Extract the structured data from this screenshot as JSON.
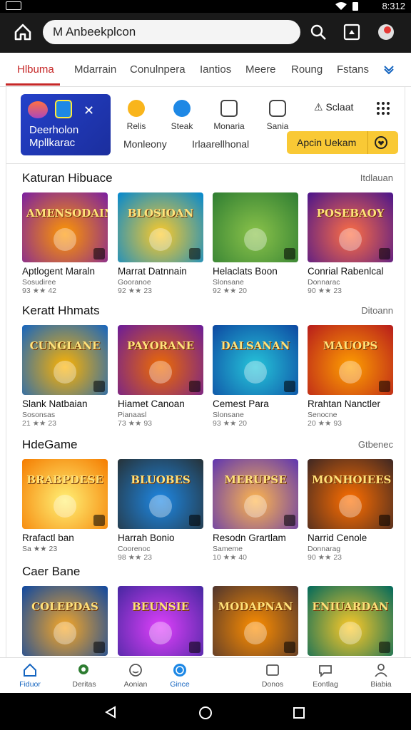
{
  "status": {
    "time": "8:312"
  },
  "appbar": {
    "search_text": "M Anbeekplcon"
  },
  "tabs": [
    {
      "label": "Hlbuma",
      "active": true
    },
    {
      "label": "Mdarrain"
    },
    {
      "label": "Conulnpera"
    },
    {
      "label": "Iantios"
    },
    {
      "label": "Meere"
    },
    {
      "label": "Roung"
    },
    {
      "label": "Fstans"
    }
  ],
  "featured": {
    "promo_text": "Deerholon Mpllkarac",
    "quick": [
      {
        "label": "Relis",
        "icon": "coin-icon"
      },
      {
        "label": "Steak",
        "icon": "compass-icon"
      },
      {
        "label": "Monaria",
        "icon": "chat-icon"
      },
      {
        "label": "Sania",
        "icon": "robot-icon"
      }
    ],
    "scan_label": "Sclaat",
    "text_left": "Monleony",
    "text_mid": "Irlaarellhonal",
    "install_label": "Apcin Uekam"
  },
  "sections": [
    {
      "title": "Katuran Hibuace",
      "more": "Itdlauan",
      "cards": [
        {
          "art": "AMENSODAIN",
          "name": "Aptlogent Maraln",
          "sub": "Sosudiree",
          "rating": "93 ★★ 42",
          "c1": "#7b1fa2",
          "c2": "#ff9800"
        },
        {
          "art": "BLOSIOAN",
          "name": "Marrat Datnnain",
          "sub": "Gooranoe",
          "rating": "92 ★★ 23",
          "c1": "#0288d1",
          "c2": "#ffca28"
        },
        {
          "art": "",
          "name": "Helaclats Boon",
          "sub": "Slonsane",
          "rating": "92 ★★ 20",
          "c1": "#2e7d32",
          "c2": "#8bc34a"
        },
        {
          "art": "POSEBAOY",
          "name": "Conrial Rabenlcal",
          "sub": "Donnarac",
          "rating": "90 ★★ 23",
          "c1": "#4a148c",
          "c2": "#ff7043"
        }
      ]
    },
    {
      "title": "Keratt Hhmats",
      "more": "Ditoann",
      "cards": [
        {
          "art": "CUNGLANE",
          "name": "Slank Natbaian",
          "sub": "Sosonsas",
          "rating": "21 ★★ 23",
          "c1": "#1565c0",
          "c2": "#ffb300"
        },
        {
          "art": "PAYORANE",
          "name": "Hiamet Canoan",
          "sub": "Pianaasl",
          "rating": "73 ★★ 93",
          "c1": "#6a1b9a",
          "c2": "#ef6c00"
        },
        {
          "art": "DALSANAN",
          "name": "Cemest Para",
          "sub": "Slonsane",
          "rating": "93 ★★ 20",
          "c1": "#0d47a1",
          "c2": "#26c6da"
        },
        {
          "art": "MAUOPS",
          "name": "Rrahtan Nanctler",
          "sub": "Senocne",
          "rating": "20 ★★ 93",
          "c1": "#b71c1c",
          "c2": "#ffa000"
        }
      ]
    },
    {
      "title": "HdeGame",
      "more": "Gtbenec",
      "cards": [
        {
          "art": "BRABPDESE",
          "name": "Rrafactl ban",
          "sub": "Sa ★★ 23",
          "rating": "",
          "c1": "#f57c00",
          "c2": "#fff176"
        },
        {
          "art": "BLUOBES",
          "name": "Harrah Bonio",
          "sub": "Coorenoc",
          "rating": "98 ★★ 23",
          "c1": "#263238",
          "c2": "#1e88e5"
        },
        {
          "art": "MERUPSE",
          "name": "Resodn Grartlam",
          "sub": "Sameme",
          "rating": "10 ★★ 40",
          "c1": "#5e35b1",
          "c2": "#ffb74d"
        },
        {
          "art": "MONHOIEES",
          "name": "Narrid Cenole",
          "sub": "Donnarag",
          "rating": "90 ★★ 23",
          "c1": "#3e2723",
          "c2": "#ff6f00"
        }
      ]
    },
    {
      "title": "Caer Bane",
      "more": "",
      "cards": [
        {
          "art": "COLEPDAS",
          "name": "",
          "sub": "",
          "rating": "",
          "c1": "#0d47a1",
          "c2": "#f9a825"
        },
        {
          "art": "BEUNSIE",
          "name": "",
          "sub": "",
          "rating": "",
          "c1": "#4527a0",
          "c2": "#e040fb"
        },
        {
          "art": "MODAPNAN",
          "name": "",
          "sub": "",
          "rating": "",
          "c1": "#4e342e",
          "c2": "#ff8f00"
        },
        {
          "art": "ENIUARDAN",
          "name": "",
          "sub": "",
          "rating": "",
          "c1": "#00695c",
          "c2": "#ffca28"
        }
      ]
    }
  ],
  "bottomnav": [
    {
      "label": "Fiduor",
      "icon": "home-icon",
      "active": true
    },
    {
      "label": "Deritas",
      "icon": "search-icon"
    },
    {
      "label": "Aonian",
      "icon": "face-icon"
    },
    {
      "label": "Gince",
      "icon": "globe-icon",
      "active": true
    },
    {
      "label": "Donos",
      "icon": "inbox-icon"
    },
    {
      "label": "Eontlag",
      "icon": "chat-icon"
    },
    {
      "label": "Biabia",
      "icon": "person-icon"
    }
  ]
}
